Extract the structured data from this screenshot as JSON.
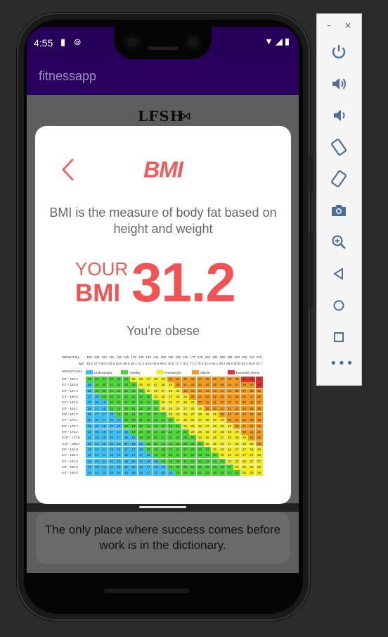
{
  "status": {
    "time": "4:55",
    "left_icons": "▮ ⊚",
    "right_icons": "▼◢▮"
  },
  "app": {
    "title": "fitnessapp",
    "logo_text": "LFSH",
    "fish_glyph": "⋈"
  },
  "dialog": {
    "heading": "BMI",
    "description": "BMI is the measure of body fat based on height and weight",
    "your_label": "YOUR",
    "bmi_label": "BMI",
    "bmi_value": "31.2",
    "status": "You're obese",
    "accent_color": "#ef5353"
  },
  "bmi_chart": {
    "weight_label": "WEIGHT lbs",
    "kgs_label": "kgs",
    "height_label": "HEIGHT in/cm",
    "weights_lbs": [
      "100",
      "105",
      "110",
      "115",
      "120",
      "125",
      "130",
      "135",
      "140",
      "145",
      "150",
      "155",
      "160",
      "165",
      "170",
      "175",
      "180",
      "185",
      "190",
      "195",
      "200",
      "205",
      "210",
      "215"
    ],
    "weights_kgs": [
      "45.5",
      "47.7",
      "50.0",
      "52.3",
      "54.5",
      "56.8",
      "59.1",
      "61.4",
      "63.6",
      "65.9",
      "68.2",
      "70.5",
      "72.7",
      "75.0",
      "77.3",
      "79.5",
      "81.8",
      "84.1",
      "86.4",
      "88.6",
      "90.9",
      "93.2",
      "95.5",
      "97.7"
    ],
    "legend": [
      {
        "label": "Underweight",
        "color": "#3dbdf2"
      },
      {
        "label": "Healthy",
        "color": "#4dd63a"
      },
      {
        "label": "Overweight",
        "color": "#f2ec1f"
      },
      {
        "label": "Obese",
        "color": "#f29a1f"
      },
      {
        "label": "Extremely obese",
        "color": "#e23131"
      }
    ],
    "heights": [
      "5'0\" - 152.4",
      "5'1\" - 154.9",
      "5'2\" - 157.4",
      "5'3\" - 160.0",
      "5'4\" - 162.5",
      "5'5\" - 165.1",
      "5'6\" - 167.6",
      "5'7\" - 170.1",
      "5'8\" - 172.7",
      "5'9\" - 175.2",
      "5'10\" - 177.8",
      "5'11\" - 180.3",
      "6'0\" - 182.8",
      "6'1\" - 185.4",
      "6'2\" - 187.9",
      "6'3\" - 190.5",
      "6'4\" - 193.0"
    ],
    "row_bmis": [
      [
        19,
        20,
        21,
        22,
        23,
        24,
        25,
        26,
        27,
        28,
        29,
        30,
        31,
        32,
        33,
        34,
        35,
        36,
        37,
        38,
        39,
        40,
        41,
        42
      ],
      [
        18,
        19,
        20,
        21,
        22,
        23,
        24,
        25,
        26,
        27,
        28,
        29,
        30,
        31,
        32,
        33,
        34,
        35,
        36,
        36,
        37,
        38,
        39,
        40
      ],
      [
        18,
        19,
        20,
        21,
        22,
        22,
        23,
        24,
        25,
        26,
        27,
        28,
        29,
        30,
        31,
        32,
        33,
        33,
        34,
        35,
        36,
        37,
        38,
        39
      ],
      [
        17,
        18,
        19,
        20,
        21,
        22,
        23,
        24,
        24,
        25,
        26,
        27,
        28,
        29,
        30,
        31,
        32,
        32,
        33,
        34,
        35,
        36,
        37,
        38
      ],
      [
        17,
        18,
        18,
        19,
        20,
        21,
        22,
        23,
        24,
        24,
        25,
        26,
        27,
        28,
        29,
        30,
        31,
        31,
        32,
        33,
        34,
        35,
        36,
        37
      ],
      [
        16,
        17,
        18,
        19,
        20,
        20,
        21,
        22,
        23,
        24,
        25,
        25,
        26,
        27,
        28,
        29,
        30,
        30,
        31,
        32,
        33,
        34,
        35,
        35
      ],
      [
        16,
        17,
        17,
        18,
        19,
        20,
        21,
        21,
        22,
        23,
        24,
        25,
        25,
        26,
        27,
        28,
        29,
        29,
        30,
        31,
        32,
        33,
        34,
        34
      ],
      [
        15,
        16,
        17,
        18,
        18,
        19,
        20,
        21,
        22,
        22,
        23,
        24,
        25,
        25,
        26,
        27,
        28,
        29,
        29,
        30,
        31,
        32,
        33,
        33
      ],
      [
        15,
        16,
        16,
        17,
        18,
        19,
        19,
        20,
        21,
        22,
        22,
        23,
        24,
        25,
        25,
        26,
        27,
        28,
        28,
        29,
        30,
        31,
        32,
        32
      ],
      [
        14,
        15,
        16,
        17,
        17,
        18,
        19,
        20,
        20,
        21,
        22,
        22,
        23,
        24,
        25,
        25,
        26,
        27,
        28,
        28,
        29,
        30,
        31,
        31
      ],
      [
        14,
        15,
        15,
        16,
        17,
        18,
        18,
        19,
        20,
        20,
        21,
        22,
        23,
        23,
        24,
        25,
        25,
        26,
        27,
        28,
        28,
        29,
        30,
        30
      ],
      [
        14,
        14,
        15,
        16,
        16,
        17,
        18,
        18,
        19,
        20,
        21,
        21,
        22,
        23,
        23,
        24,
        25,
        25,
        26,
        27,
        28,
        28,
        29,
        30
      ],
      [
        13,
        14,
        14,
        15,
        16,
        17,
        17,
        18,
        19,
        19,
        20,
        21,
        21,
        22,
        23,
        23,
        24,
        25,
        25,
        26,
        27,
        27,
        28,
        29
      ],
      [
        13,
        13,
        14,
        15,
        15,
        16,
        17,
        17,
        18,
        19,
        19,
        20,
        21,
        21,
        22,
        23,
        23,
        24,
        25,
        25,
        26,
        27,
        27,
        28
      ],
      [
        12,
        13,
        14,
        14,
        15,
        16,
        16,
        17,
        18,
        18,
        19,
        19,
        20,
        21,
        21,
        22,
        23,
        23,
        24,
        25,
        25,
        26,
        27,
        27
      ],
      [
        12,
        13,
        13,
        14,
        15,
        15,
        16,
        16,
        17,
        18,
        18,
        19,
        20,
        20,
        21,
        21,
        22,
        23,
        23,
        24,
        25,
        25,
        26,
        26
      ],
      [
        12,
        12,
        13,
        14,
        14,
        15,
        15,
        16,
        17,
        17,
        18,
        18,
        19,
        20,
        20,
        21,
        22,
        22,
        23,
        23,
        24,
        25,
        25,
        26
      ]
    ]
  },
  "quote": {
    "text": "The only place where success comes before work is in the dictionary."
  },
  "emulator": {
    "minimize_label": "–",
    "close_label": "×",
    "more_label": "•••",
    "icons": [
      "power-icon",
      "volume-up-icon",
      "volume-down-icon",
      "rotate-left-icon",
      "rotate-right-icon",
      "camera-icon",
      "zoom-icon",
      "back-icon",
      "home-icon",
      "overview-icon"
    ]
  }
}
